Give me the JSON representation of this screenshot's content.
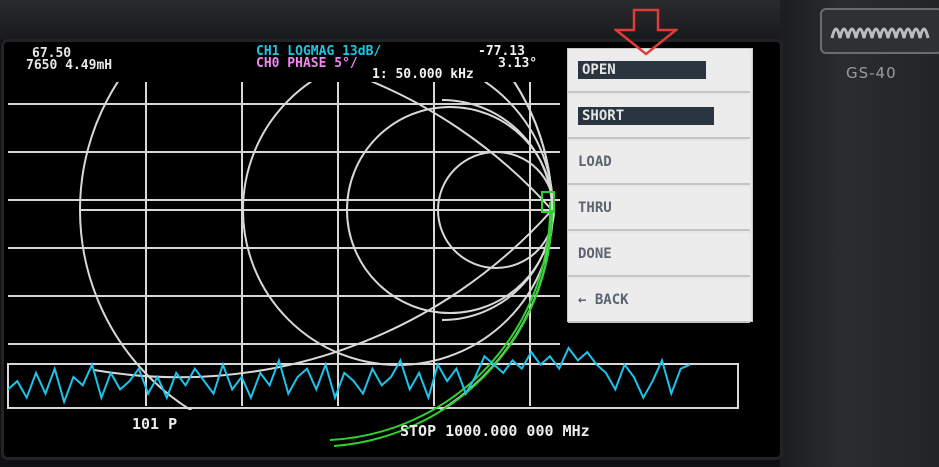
{
  "device": {
    "model_label": "GS-40"
  },
  "status": {
    "marker_line1": "67.50",
    "marker_line2": "7650 4.49mH",
    "ch1_label": "CH1 LOGMAG 13dB/",
    "ch1_value": "-77.13",
    "ch0_label": "CH0 PHASE 5°/",
    "ch0_value": "3.13°",
    "marker_freq": "1: 50.000 kHz"
  },
  "footer": {
    "points": "101 P",
    "stop": "STOP 1000.000 000 MHz"
  },
  "menu": {
    "items": [
      {
        "label": "OPEN",
        "selected": true
      },
      {
        "label": "SHORT",
        "selected": true
      },
      {
        "label": "LOAD",
        "selected": false
      },
      {
        "label": "THRU",
        "selected": false
      },
      {
        "label": "DONE",
        "selected": false
      },
      {
        "label": "← BACK",
        "selected": false
      }
    ]
  },
  "annotation": {
    "arrow_color": "#e23b3b"
  },
  "colors": {
    "grid": "#d8d8d8",
    "smith_trace": "#2fd12f",
    "logmag_trace": "#1ec3ea",
    "menu_bg": "#e6e6e6",
    "menu_selected": "#2b3540"
  },
  "chart_data": {
    "type": "line",
    "series": [
      {
        "channel": "CH1",
        "trace": "logmag",
        "values": [
          -70,
          -66,
          -74,
          -62,
          -72,
          -60,
          -76,
          -64,
          -68,
          -58,
          -74,
          -62,
          -70,
          -66,
          -60,
          -72,
          -64,
          -74,
          -62,
          -68,
          -60,
          -66,
          -72,
          -58,
          -70,
          -64,
          -74,
          -62,
          -68,
          -56,
          -72,
          -64,
          -60,
          -70,
          -58,
          -74,
          -62,
          -66,
          -72,
          -60,
          -68,
          -64,
          -56,
          -70,
          -62,
          -74,
          -58,
          -66,
          -60,
          -72,
          -64,
          -54,
          -58,
          -62,
          -56,
          -60,
          -52,
          -58,
          -54,
          -60,
          -50,
          -56,
          -52,
          -58,
          -62,
          -70,
          -58,
          -64,
          -74,
          -66,
          -56,
          -72,
          -60,
          -58
        ]
      }
    ]
  }
}
